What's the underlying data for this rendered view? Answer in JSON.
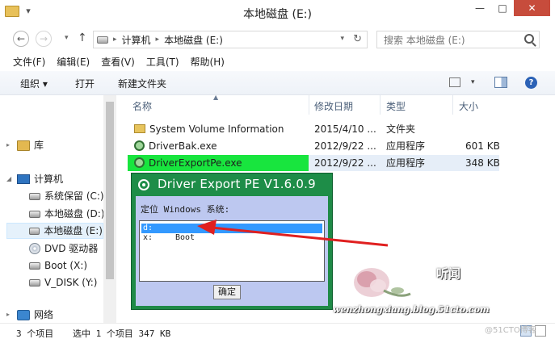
{
  "window": {
    "title": "本地磁盘 (E:)",
    "qa_icon": "▾",
    "minimize": "—",
    "maximize": "□",
    "close": "✕"
  },
  "address": {
    "back": "←",
    "forward": "→",
    "history": "▾",
    "up": "↑",
    "crumbs": [
      "计算机",
      "本地磁盘 (E:)"
    ],
    "crumb_sep": "▸",
    "dropdown": "▾",
    "refresh": "↻",
    "search_placeholder": "搜索 本地磁盘 (E:)"
  },
  "menu": [
    "文件(F)",
    "编辑(E)",
    "查看(V)",
    "工具(T)",
    "帮助(H)"
  ],
  "commands": {
    "organize": "组织 ▾",
    "open": "打开",
    "new_folder": "新建文件夹",
    "view_dropdown": "▾",
    "help": "?"
  },
  "nav": {
    "library": "库",
    "computer": "计算机",
    "drives": [
      {
        "label": "系统保留 (C:)",
        "icon": "drive-icon"
      },
      {
        "label": "本地磁盘 (D:)",
        "icon": "drive-icon"
      },
      {
        "label": "本地磁盘 (E:)",
        "icon": "drive-icon",
        "selected": true
      },
      {
        "label": "DVD 驱动器",
        "icon": "dvd-icon"
      },
      {
        "label": "Boot (X:)",
        "icon": "drive-icon"
      },
      {
        "label": "V_DISK (Y:)",
        "icon": "drive-icon"
      }
    ],
    "network": "网络",
    "expand_arrow": "▸",
    "collapse_arrow": "◢"
  },
  "columns": {
    "name": "名称",
    "date": "修改日期",
    "type": "类型",
    "size": "大小",
    "sort_arrow": "▲"
  },
  "files": [
    {
      "name": "System Volume Information",
      "date": "2015/4/10 ...",
      "type": "文件夹",
      "size": "",
      "icon": "folder-icon"
    },
    {
      "name": "DriverBak.exe",
      "date": "2012/9/22 ...",
      "type": "应用程序",
      "size": "601 KB",
      "icon": "exe-icon"
    },
    {
      "name": "DriverExportPe.exe",
      "date": "2012/9/22 ...",
      "type": "应用程序",
      "size": "348 KB",
      "icon": "exe-icon",
      "selected": true
    }
  ],
  "status": {
    "count": "3 个项目",
    "selection": "选中 1 个项目  347 KB"
  },
  "dialog": {
    "title": "Driver Export PE V1.6.0.9",
    "prompt": "定位 Windows 系统:",
    "list": [
      {
        "drive": "d:",
        "label": "",
        "selected": true
      },
      {
        "drive": "x:",
        "label": "Boot",
        "selected": false
      }
    ],
    "ok": "确定"
  },
  "colors": {
    "dialog_green": "#1f8a47",
    "highlight_green": "#18e53e",
    "annotation_red": "#e02020",
    "close_red": "#c74c3c"
  },
  "watermark": {
    "signature": "听闻",
    "url": "wenzhongxiang.blog.51cto.com",
    "blog": "@51CTO博客"
  }
}
